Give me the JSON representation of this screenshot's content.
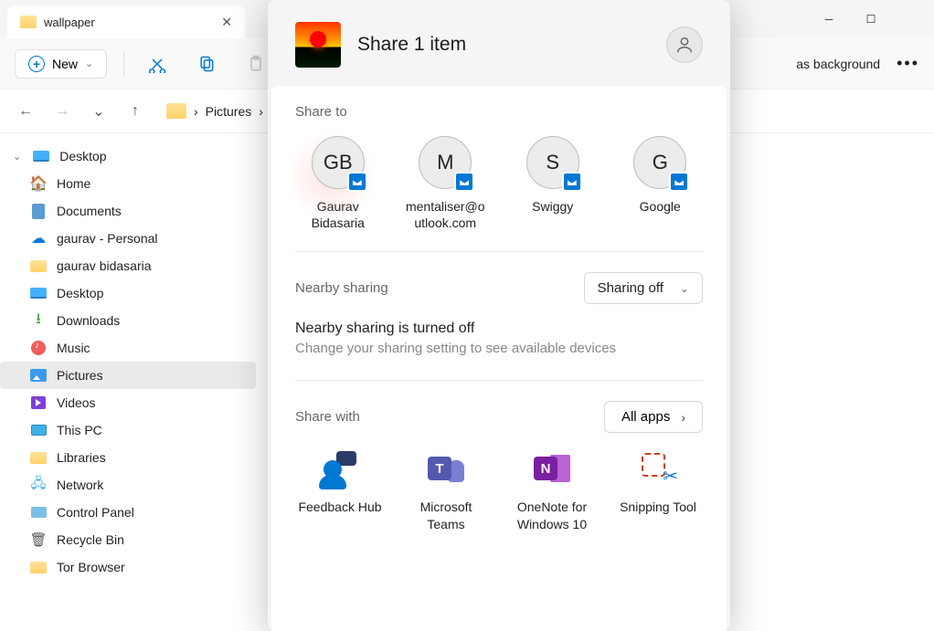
{
  "tab": {
    "title": "wallpaper"
  },
  "toolbar": {
    "new_label": "New",
    "bg_label": "as background"
  },
  "breadcrumb": {
    "item1": "Pictures",
    "sep": "›"
  },
  "sidebar": {
    "items": [
      {
        "label": "Desktop"
      },
      {
        "label": "Home"
      },
      {
        "label": "Documents"
      },
      {
        "label": "gaurav - Personal"
      },
      {
        "label": "gaurav bidasaria"
      },
      {
        "label": "Desktop"
      },
      {
        "label": "Downloads"
      },
      {
        "label": "Music"
      },
      {
        "label": "Pictures"
      },
      {
        "label": "Videos"
      },
      {
        "label": "This PC"
      },
      {
        "label": "Libraries"
      },
      {
        "label": "Network"
      },
      {
        "label": "Control Panel"
      },
      {
        "label": "Recycle Bin"
      },
      {
        "label": "Tor Browser"
      }
    ]
  },
  "share": {
    "title": "Share 1 item",
    "share_to_label": "Share to",
    "contacts": [
      {
        "initials": "GB",
        "name": "Gaurav Bidasaria"
      },
      {
        "initials": "M",
        "name": "mentaliser@outlook.com"
      },
      {
        "initials": "S",
        "name": "Swiggy"
      },
      {
        "initials": "G",
        "name": "Google"
      }
    ],
    "nearby": {
      "label": "Nearby sharing",
      "selected": "Sharing off",
      "status": "Nearby sharing is turned off",
      "sub": "Change your sharing setting to see available devices"
    },
    "share_with_label": "Share with",
    "all_apps_label": "All apps",
    "apps": [
      {
        "name": "Feedback Hub"
      },
      {
        "name": "Microsoft Teams"
      },
      {
        "name": "OneNote for Windows 10"
      },
      {
        "name": "Snipping Tool"
      }
    ]
  }
}
